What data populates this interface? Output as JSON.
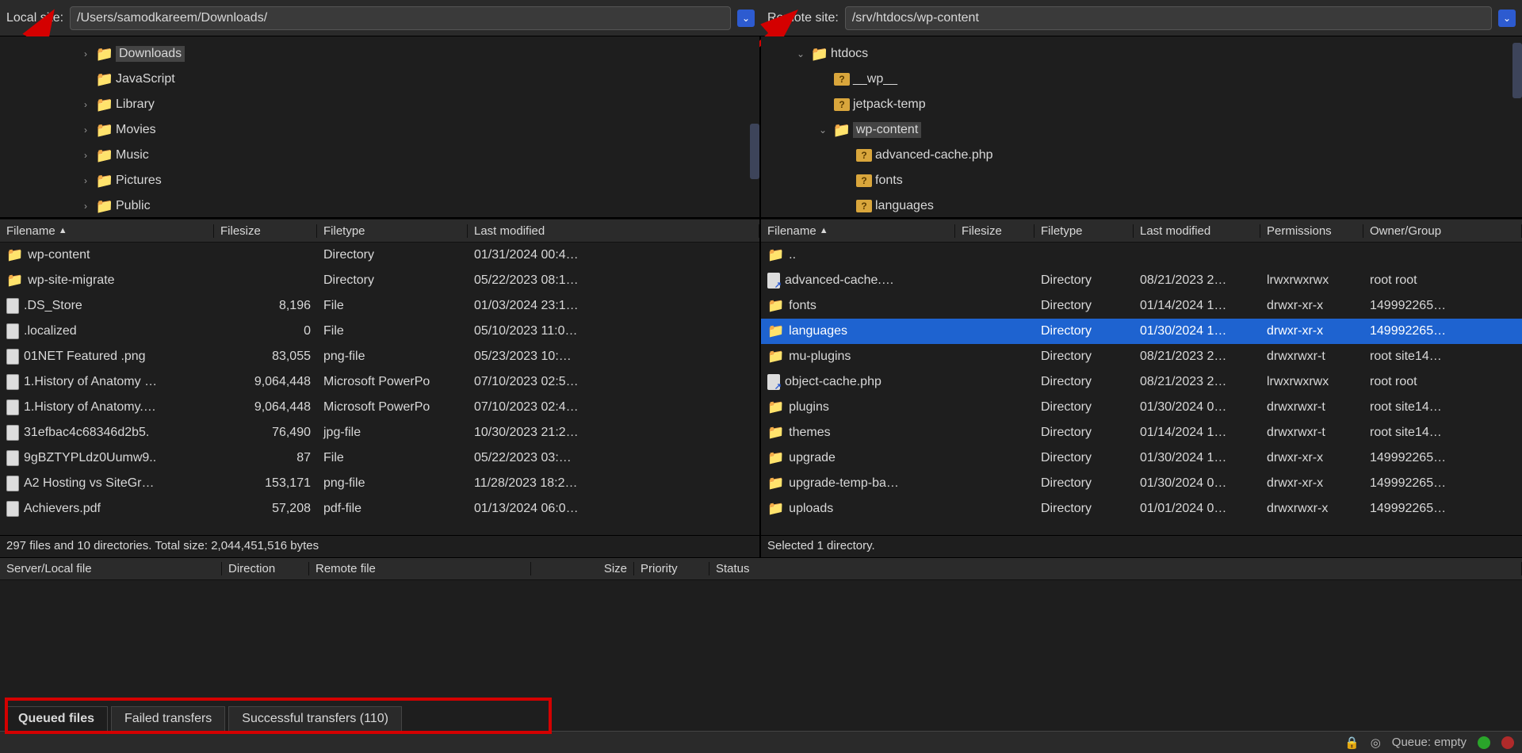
{
  "local": {
    "label": "Local site:",
    "path": "/Users/samodkareem/Downloads/",
    "tree": [
      {
        "indent": 1,
        "disclosure": "›",
        "icon": "folder",
        "label": "Downloads",
        "selected": true
      },
      {
        "indent": 1,
        "disclosure": "",
        "icon": "folder",
        "label": "JavaScript"
      },
      {
        "indent": 1,
        "disclosure": "›",
        "icon": "folder",
        "label": "Library"
      },
      {
        "indent": 1,
        "disclosure": "›",
        "icon": "folder",
        "label": "Movies"
      },
      {
        "indent": 1,
        "disclosure": "›",
        "icon": "folder",
        "label": "Music"
      },
      {
        "indent": 1,
        "disclosure": "›",
        "icon": "folder",
        "label": "Pictures"
      },
      {
        "indent": 1,
        "disclosure": "›",
        "icon": "folder",
        "label": "Public"
      }
    ],
    "columns": {
      "name": "Filename",
      "size": "Filesize",
      "type": "Filetype",
      "mod": "Last modified"
    },
    "files": [
      {
        "icon": "dir",
        "name": "wp-content",
        "size": "",
        "type": "Directory",
        "mod": "01/31/2024 00:4…"
      },
      {
        "icon": "dir",
        "name": "wp-site-migrate",
        "size": "",
        "type": "Directory",
        "mod": "05/22/2023 08:1…"
      },
      {
        "icon": "file",
        "name": ".DS_Store",
        "size": "8,196",
        "type": "File",
        "mod": "01/03/2024 23:1…"
      },
      {
        "icon": "file",
        "name": ".localized",
        "size": "0",
        "type": "File",
        "mod": "05/10/2023 11:0…"
      },
      {
        "icon": "file",
        "name": "01NET Featured .png",
        "size": "83,055",
        "type": "png-file",
        "mod": "05/23/2023 10:…"
      },
      {
        "icon": "file",
        "name": "1.History of Anatomy …",
        "size": "9,064,448",
        "type": "Microsoft PowerPo",
        "mod": "07/10/2023 02:5…"
      },
      {
        "icon": "file",
        "name": "1.History of Anatomy.…",
        "size": "9,064,448",
        "type": "Microsoft PowerPo",
        "mod": "07/10/2023 02:4…"
      },
      {
        "icon": "file",
        "name": "31efbac4c68346d2b5.",
        "size": "76,490",
        "type": "jpg-file",
        "mod": "10/30/2023 21:2…"
      },
      {
        "icon": "file",
        "name": "9gBZTYPLdz0Uumw9..",
        "size": "87",
        "type": "File",
        "mod": "05/22/2023 03:…"
      },
      {
        "icon": "file",
        "name": "A2 Hosting vs SiteGr…",
        "size": "153,171",
        "type": "png-file",
        "mod": "11/28/2023 18:2…"
      },
      {
        "icon": "file",
        "name": "Achievers.pdf",
        "size": "57,208",
        "type": "pdf-file",
        "mod": "01/13/2024 06:0…"
      }
    ],
    "status": "297 files and 10 directories. Total size: 2,044,451,516 bytes"
  },
  "remote": {
    "label": "Remote site:",
    "path": "/srv/htdocs/wp-content",
    "tree": [
      {
        "indent": 0,
        "disclosure": "⌄",
        "icon": "folder",
        "label": "htdocs"
      },
      {
        "indent": 1,
        "disclosure": "",
        "icon": "folderq",
        "label": "__wp__"
      },
      {
        "indent": 1,
        "disclosure": "",
        "icon": "folderq",
        "label": "jetpack-temp"
      },
      {
        "indent": 1,
        "disclosure": "⌄",
        "icon": "folder",
        "label": "wp-content",
        "selected": true
      },
      {
        "indent": 2,
        "disclosure": "",
        "icon": "folderq",
        "label": "advanced-cache.php"
      },
      {
        "indent": 2,
        "disclosure": "",
        "icon": "folderq",
        "label": "fonts"
      },
      {
        "indent": 2,
        "disclosure": "",
        "icon": "folderq",
        "label": "languages"
      }
    ],
    "columns": {
      "name": "Filename",
      "size": "Filesize",
      "type": "Filetype",
      "mod": "Last modified",
      "perm": "Permissions",
      "own": "Owner/Group"
    },
    "files": [
      {
        "icon": "dir",
        "name": "..",
        "type": "",
        "mod": "",
        "perm": "",
        "own": ""
      },
      {
        "icon": "link",
        "name": "advanced-cache.…",
        "type": "Directory",
        "mod": "08/21/2023 2…",
        "perm": "lrwxrwxrwx",
        "own": "root root"
      },
      {
        "icon": "dir",
        "name": "fonts",
        "type": "Directory",
        "mod": "01/14/2024 1…",
        "perm": "drwxr-xr-x",
        "own": "149992265…"
      },
      {
        "icon": "dir",
        "name": "languages",
        "type": "Directory",
        "mod": "01/30/2024 1…",
        "perm": "drwxr-xr-x",
        "own": "149992265…",
        "selected": true
      },
      {
        "icon": "dir",
        "name": "mu-plugins",
        "type": "Directory",
        "mod": "08/21/2023 2…",
        "perm": "drwxrwxr-t",
        "own": "root site14…"
      },
      {
        "icon": "link",
        "name": "object-cache.php",
        "type": "Directory",
        "mod": "08/21/2023 2…",
        "perm": "lrwxrwxrwx",
        "own": "root root"
      },
      {
        "icon": "dir",
        "name": "plugins",
        "type": "Directory",
        "mod": "01/30/2024 0…",
        "perm": "drwxrwxr-t",
        "own": "root site14…"
      },
      {
        "icon": "dir",
        "name": "themes",
        "type": "Directory",
        "mod": "01/14/2024 1…",
        "perm": "drwxrwxr-t",
        "own": "root site14…"
      },
      {
        "icon": "dir",
        "name": "upgrade",
        "type": "Directory",
        "mod": "01/30/2024 1…",
        "perm": "drwxr-xr-x",
        "own": "149992265…"
      },
      {
        "icon": "dir",
        "name": "upgrade-temp-ba…",
        "type": "Directory",
        "mod": "01/30/2024 0…",
        "perm": "drwxr-xr-x",
        "own": "149992265…"
      },
      {
        "icon": "dir",
        "name": "uploads",
        "type": "Directory",
        "mod": "01/01/2024 0…",
        "perm": "drwxrwxr-x",
        "own": "149992265…"
      }
    ],
    "status": "Selected 1 directory."
  },
  "queue_columns": {
    "file": "Server/Local file",
    "dir": "Direction",
    "rem": "Remote file",
    "size": "Size",
    "pri": "Priority",
    "stat": "Status"
  },
  "tabs": {
    "queued": "Queued files",
    "failed": "Failed transfers",
    "success": "Successful transfers (110)"
  },
  "statusbar": {
    "queue": "Queue: empty"
  }
}
